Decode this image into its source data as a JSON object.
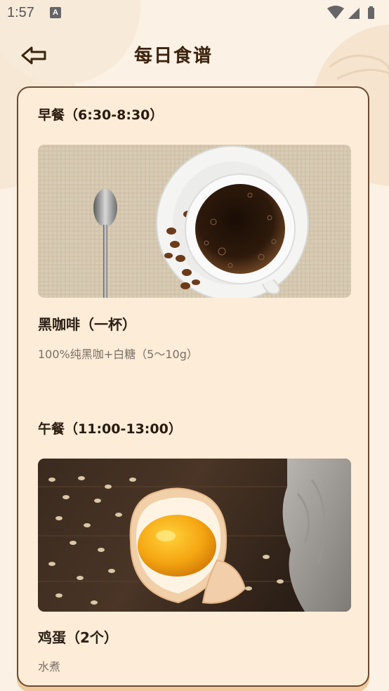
{
  "status_bar": {
    "time": "1:57",
    "notification_icon": "A"
  },
  "header": {
    "title": "每日食谱",
    "back_icon": "back-arrow-icon"
  },
  "meals": [
    {
      "title": "早餐（6:30-8:30）",
      "photo": "black-coffee-photo",
      "dish": "黑咖啡（一杯）",
      "desc": "100%纯黑咖+白糖（5～10g）"
    },
    {
      "title": "午餐（11:00-13:00）",
      "photo": "egg-photo",
      "dish": "鸡蛋（2个）",
      "desc": "水煮"
    }
  ]
}
